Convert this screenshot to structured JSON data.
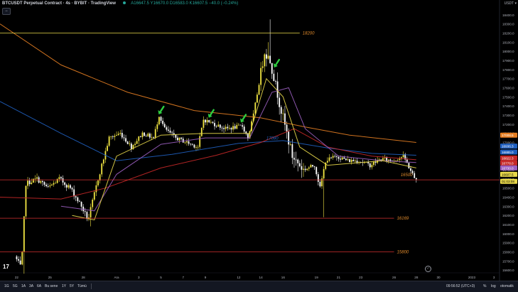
{
  "header": {
    "title": "BTCUSDT Perpetual Contract · 4s · BYBIT · TradingView",
    "ohlc": "A16647.5  Y16670.0  D16583.0  K16607.5  −40.0 (−0.24%)"
  },
  "currency_label": "USDT ▾",
  "timeframes": [
    "1G",
    "5G",
    "1A",
    "3A",
    "6A",
    "Bu sene",
    "1Y",
    "5Y",
    "Tümü"
  ],
  "footer": {
    "time": "09:56:52 (UTC+3)",
    "percent": "%",
    "log": "log",
    "auto": "otomatik"
  },
  "colors": {
    "bull": "#f0e442",
    "bear": "#ffffff",
    "hline_yellow": "#e8d84a",
    "hline_red": "#d32f2f",
    "annot_orange": "#e08a2b",
    "annot_blue": "#3aa0d8",
    "ma_orange": "#e67e22",
    "ma_blue": "#1f5fbf",
    "ma_red": "#c62828",
    "ma_purple": "#9b5fc0",
    "ma_yellow": "#e8d84a",
    "arrow": "#2ecc40"
  },
  "chart_data": {
    "type": "candlestick",
    "symbol": "BTCUSDT",
    "timeframe": "4h",
    "ylim": [
      15500,
      18500
    ],
    "y_ticks": [
      15600,
      15700,
      15800,
      15900,
      16000,
      16100,
      16200,
      16300,
      16400,
      16500,
      16600,
      16700,
      16800,
      16900,
      17000,
      17100,
      17200,
      17300,
      17400,
      17500,
      17600,
      17700,
      17800,
      17900,
      18000,
      18100,
      18200,
      18300,
      18400
    ],
    "x_ticks": [
      "22",
      "25",
      "28",
      "Ara",
      "3",
      "5",
      "7",
      "9",
      "12",
      "14",
      "16",
      "19",
      "21",
      "23",
      "26",
      "28",
      "30",
      "2023",
      "3"
    ],
    "x_tick_days": [
      0,
      3,
      6,
      9,
      11,
      13,
      15,
      17,
      20,
      22,
      24,
      27,
      29,
      31,
      34,
      36,
      38,
      41,
      43
    ],
    "xlim_days": [
      -1.5,
      43.5
    ],
    "anchors": [
      [
        0.0,
        15750
      ],
      [
        0.6,
        15620
      ],
      [
        1.0,
        16550
      ],
      [
        2.0,
        16600
      ],
      [
        3.0,
        16500
      ],
      [
        4.0,
        16600
      ],
      [
        5.0,
        16500
      ],
      [
        6.0,
        16300
      ],
      [
        6.6,
        16150
      ],
      [
        7.5,
        16600
      ],
      [
        8.5,
        17050
      ],
      [
        9.5,
        17100
      ],
      [
        10.5,
        16950
      ],
      [
        11.5,
        17100
      ],
      [
        12.5,
        17050
      ],
      [
        13.0,
        17300
      ],
      [
        13.5,
        17150
      ],
      [
        14.5,
        17050
      ],
      [
        15.5,
        17000
      ],
      [
        16.5,
        16950
      ],
      [
        17.0,
        17250
      ],
      [
        18.0,
        17200
      ],
      [
        19.0,
        17150
      ],
      [
        20.5,
        17180
      ],
      [
        21.0,
        17050
      ],
      [
        21.5,
        17300
      ],
      [
        22.5,
        18000
      ],
      [
        23.0,
        17900
      ],
      [
        24.0,
        17350
      ],
      [
        25.0,
        16850
      ],
      [
        26.0,
        16700
      ],
      [
        27.0,
        16750
      ],
      [
        27.5,
        16500
      ],
      [
        28.0,
        16800
      ],
      [
        29.0,
        16850
      ],
      [
        30.0,
        16800
      ],
      [
        31.0,
        16800
      ],
      [
        32.0,
        16750
      ],
      [
        33.0,
        16820
      ],
      [
        34.0,
        16800
      ],
      [
        35.0,
        16850
      ],
      [
        36.0,
        16610
      ]
    ],
    "horizontal_levels": [
      {
        "price": 18200,
        "color": "yellow",
        "label": "18200",
        "x_from": -1.5,
        "x_to": 25.5
      },
      {
        "price": 16590,
        "color": "red",
        "label": "16500",
        "x_from": -1.5,
        "x_to": 43.5
      },
      {
        "price": 16169,
        "color": "red",
        "label": "16169",
        "x_from": -1.5,
        "x_to": 34.0
      },
      {
        "price": 15800,
        "color": "red",
        "label": "15800",
        "x_from": -1.5,
        "x_to": 34.0
      }
    ],
    "annotations": [
      {
        "text": "17080",
        "day": 22.5,
        "price": 17030,
        "color": "blue"
      }
    ],
    "arrows_days": [
      12.8,
      17.3,
      20.2,
      23.2
    ],
    "moving_averages": [
      {
        "color": "orange",
        "points": [
          [
            -1.5,
            18300
          ],
          [
            4.0,
            17850
          ],
          [
            10.0,
            17550
          ],
          [
            16.0,
            17350
          ],
          [
            22.0,
            17270
          ],
          [
            26.0,
            17170
          ],
          [
            30.0,
            17080
          ],
          [
            36.0,
            17000
          ]
        ]
      },
      {
        "color": "blue",
        "points": [
          [
            -1.5,
            17450
          ],
          [
            4.0,
            17100
          ],
          [
            9.0,
            16800
          ],
          [
            14.0,
            16870
          ],
          [
            20.0,
            16990
          ],
          [
            24.0,
            17020
          ],
          [
            28.0,
            16940
          ],
          [
            32.0,
            16880
          ],
          [
            36.0,
            16860
          ]
        ]
      },
      {
        "color": "red",
        "points": [
          [
            -1.5,
            16400
          ],
          [
            4.0,
            16380
          ],
          [
            8.0,
            16500
          ],
          [
            13.0,
            16720
          ],
          [
            18.0,
            16860
          ],
          [
            22.0,
            17000
          ],
          [
            25.0,
            17150
          ],
          [
            28.0,
            16950
          ],
          [
            32.0,
            16850
          ],
          [
            36.0,
            16810
          ]
        ]
      },
      {
        "color": "purple",
        "points": [
          [
            4.0,
            16300
          ],
          [
            7.0,
            16250
          ],
          [
            9.0,
            16650
          ],
          [
            13.0,
            16980
          ],
          [
            17.0,
            17050
          ],
          [
            21.0,
            17050
          ],
          [
            23.0,
            17550
          ],
          [
            24.5,
            17600
          ],
          [
            26.0,
            17150
          ],
          [
            29.0,
            16850
          ],
          [
            33.0,
            16800
          ],
          [
            36.0,
            16780
          ]
        ]
      },
      {
        "color": "yellow",
        "points": [
          [
            5.0,
            16200
          ],
          [
            7.0,
            16150
          ],
          [
            9.0,
            16850
          ],
          [
            13.0,
            17080
          ],
          [
            17.0,
            17100
          ],
          [
            21.0,
            17100
          ],
          [
            22.5,
            17700
          ],
          [
            24.0,
            17500
          ],
          [
            25.5,
            16950
          ],
          [
            28.0,
            16750
          ],
          [
            33.0,
            16800
          ],
          [
            36.0,
            16720
          ]
        ]
      }
    ],
    "price_badges": [
      {
        "label": "17008.5",
        "price": 17080,
        "color": "orange"
      },
      {
        "label": "16936.3",
        "price": 16960,
        "color": "blue"
      },
      {
        "label": "16885.0",
        "price": 16895,
        "color": "blue"
      },
      {
        "label": "16822.3",
        "price": 16830,
        "color": "red"
      },
      {
        "label": "16778.0",
        "price": 16775,
        "color": "red"
      },
      {
        "label": "16730.0",
        "price": 16720,
        "color": "purple"
      },
      {
        "label": "16607.5",
        "price": 16650,
        "color": "yellow"
      },
      {
        "label": "01:03:08",
        "price": 16605,
        "color": "yellow"
      }
    ]
  }
}
